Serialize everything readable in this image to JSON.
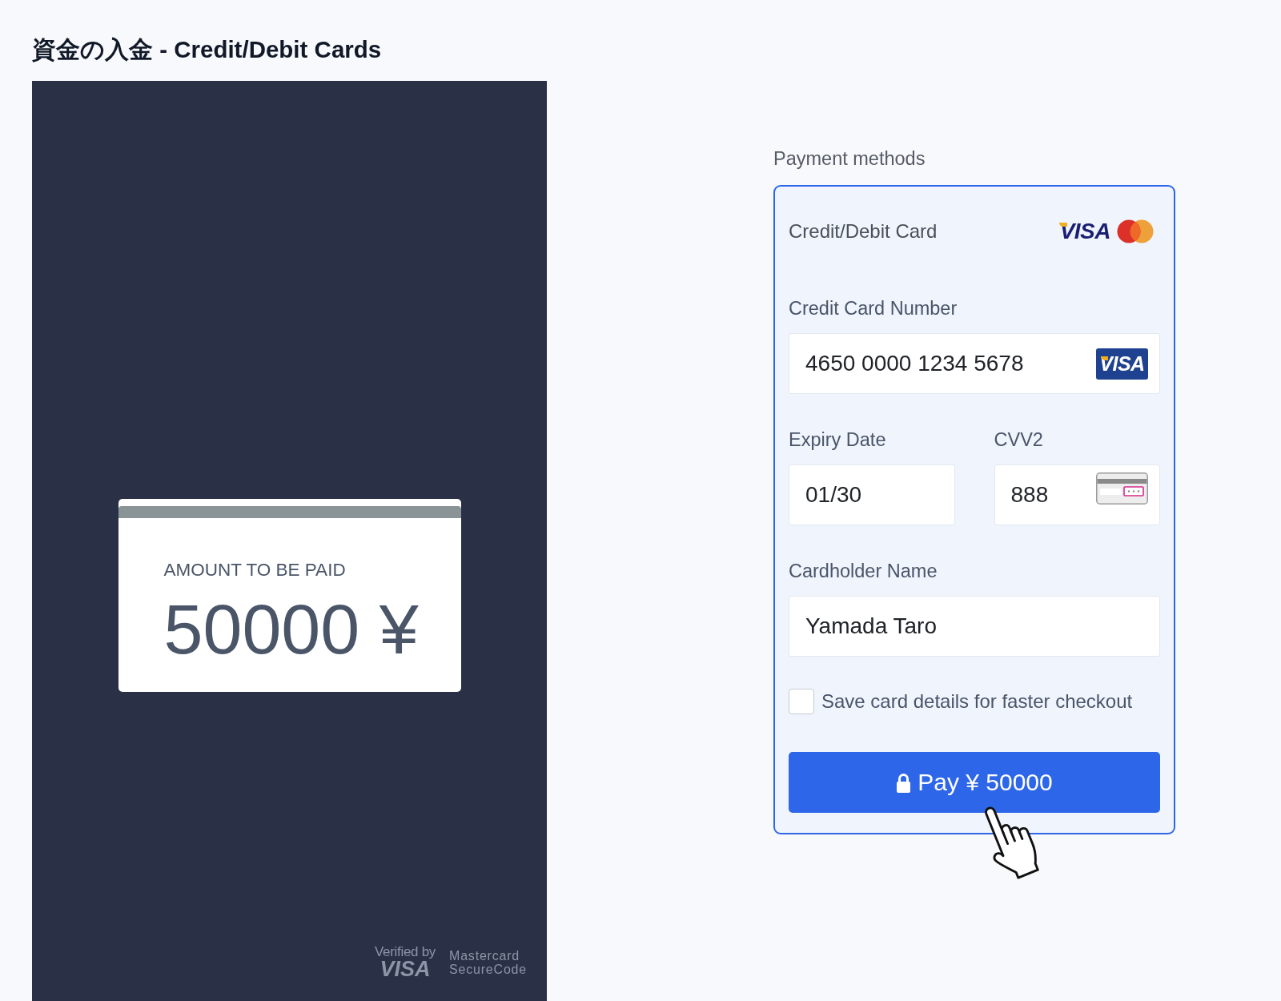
{
  "page_title": "資金の入金 - Credit/Debit Cards",
  "summary": {
    "label": "AMOUNT TO BE PAID",
    "amount": "50000 ¥",
    "security_badges": [
      {
        "kind": "visa",
        "lines": [
          "Verified by",
          "VISA"
        ]
      },
      {
        "kind": "mastercard",
        "lines": [
          "Mastercard",
          "SecureCode"
        ]
      }
    ]
  },
  "payment": {
    "heading": "Payment methods",
    "method": {
      "label": "Credit/Debit Card",
      "selected": true,
      "logos": [
        {
          "kind": "visa",
          "label": "VISA"
        },
        {
          "kind": "mastercard"
        }
      ]
    },
    "fields": [
      {
        "kind": "card_number",
        "label": "Credit Card Number",
        "value": "4650 0000 1234 5678",
        "badge": {
          "kind": "visa",
          "label": "VISA"
        }
      },
      {
        "kind": "expiry",
        "label": "Expiry Date",
        "value": "01/30"
      },
      {
        "kind": "cvv",
        "label": "CVV2",
        "value": "888",
        "badge": {
          "kind": "cvv"
        }
      },
      {
        "kind": "name",
        "label": "Cardholder Name",
        "value": "Yamada Taro"
      }
    ],
    "save_card": {
      "label": "Save card details for faster checkout",
      "checked": false
    },
    "pay_button": {
      "label": "Pay ¥ 50000"
    }
  }
}
